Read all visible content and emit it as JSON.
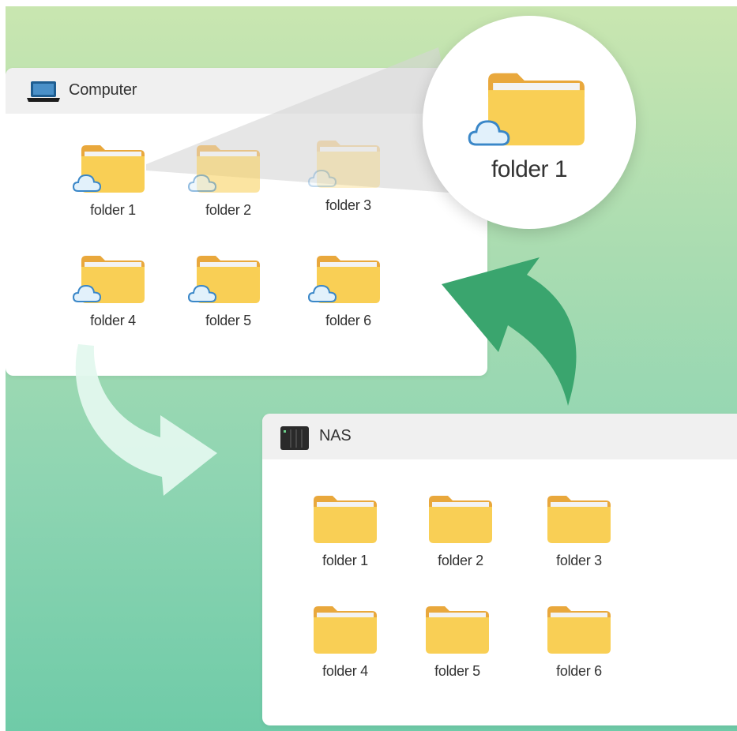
{
  "computer": {
    "title": "Computer",
    "icon": "laptop-icon",
    "folders": [
      "folder 1",
      "folder 2",
      "folder 3",
      "folder 4",
      "folder 5",
      "folder 6"
    ]
  },
  "zoom": {
    "label": "folder 1",
    "icon": "folder-icon"
  },
  "nas": {
    "title": "NAS",
    "icon": "nas-server-icon",
    "folders": [
      "folder 1",
      "folder 2",
      "folder 3",
      "folder 4",
      "folder 5",
      "folder 6"
    ]
  },
  "colors": {
    "folder_body": "#f9cf55",
    "folder_back": "#e9a83c",
    "cloud_fill": "#e2f1fb",
    "cloud_stroke": "#3a87c8",
    "arrow_dark": "#3aa56e",
    "arrow_light": "#e3f8ee"
  }
}
